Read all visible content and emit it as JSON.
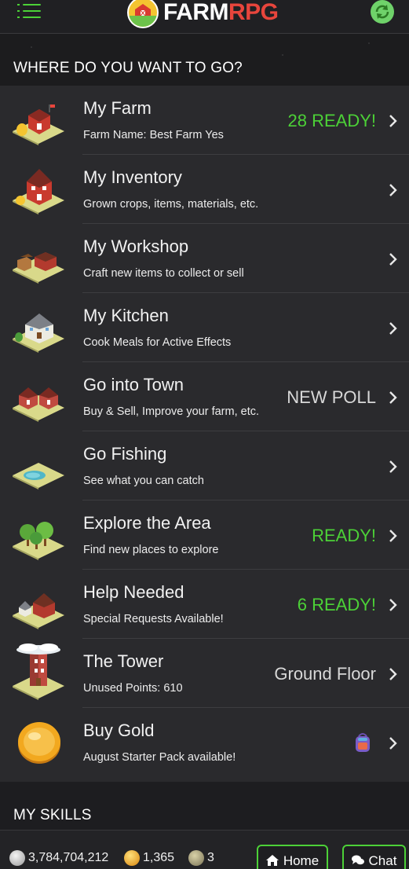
{
  "header": {
    "logo_farm": "FARM",
    "logo_rpg": "RPG",
    "menu_icon": "menu-icon",
    "refresh_icon": "refresh-icon"
  },
  "colors": {
    "accent_green": "#4cd137",
    "status_green": "#4cd137",
    "status_gray": "#d8d8d8",
    "logo_red": "#e8453c"
  },
  "sections": {
    "where": "WHERE DO YOU WANT TO GO?",
    "skills": "MY SKILLS"
  },
  "locations": [
    {
      "title": "My Farm",
      "subtitle": "Farm Name: Best Farm Yes",
      "status": "28 READY!",
      "status_color": "green",
      "icon": "farm-icon"
    },
    {
      "title": "My Inventory",
      "subtitle": "Grown crops, items, materials, etc.",
      "status": "",
      "status_color": "",
      "icon": "inventory-icon"
    },
    {
      "title": "My Workshop",
      "subtitle": "Craft new items to collect or sell",
      "status": "",
      "status_color": "",
      "icon": "workshop-icon"
    },
    {
      "title": "My Kitchen",
      "subtitle": "Cook Meals for Active Effects",
      "status": "",
      "status_color": "",
      "icon": "kitchen-icon"
    },
    {
      "title": "Go into Town",
      "subtitle": "Buy & Sell, Improve your farm, etc.",
      "status": "NEW POLL",
      "status_color": "gray",
      "icon": "town-icon"
    },
    {
      "title": "Go Fishing",
      "subtitle": "See what you can catch",
      "status": "",
      "status_color": "",
      "icon": "fishing-icon"
    },
    {
      "title": "Explore the Area",
      "subtitle": "Find new places to explore",
      "status": "READY!",
      "status_color": "green",
      "icon": "explore-icon"
    },
    {
      "title": "Help Needed",
      "subtitle": "Special Requests Available!",
      "status": "6 READY!",
      "status_color": "green",
      "icon": "help-icon"
    },
    {
      "title": "The Tower",
      "subtitle": "Unused Points: 610",
      "status": "Ground Floor",
      "status_color": "gray",
      "icon": "tower-icon"
    },
    {
      "title": "Buy Gold",
      "subtitle": "August Starter Pack available!",
      "status": "",
      "status_color": "",
      "icon": "gold-coin-icon",
      "badge_icon": "backpack-icon"
    }
  ],
  "currency": {
    "silver": "3,784,704,212",
    "gold": "1,365",
    "ancient": "3"
  },
  "nav": {
    "home": "Home",
    "chat": "Chat"
  }
}
